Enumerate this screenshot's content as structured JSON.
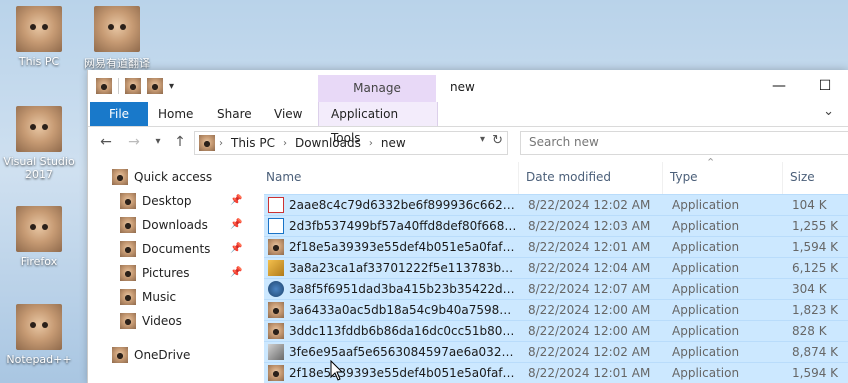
{
  "desktop": {
    "icons": [
      {
        "label": "This PC"
      },
      {
        "label": "网易有道翻译"
      },
      {
        "label": "Visual Studio 2017"
      },
      {
        "label": "Firefox"
      },
      {
        "label": "Notepad++"
      }
    ]
  },
  "window": {
    "title": "new",
    "manage_tab": "Manage",
    "controls": {
      "minimize": "—",
      "maximize": "☐"
    }
  },
  "ribbon": {
    "tabs": [
      "File",
      "Home",
      "Share",
      "View",
      "Application Tools"
    ],
    "expand_icon": "⌄"
  },
  "address": {
    "crumbs": [
      "This PC",
      "Downloads",
      "new"
    ],
    "search_placeholder": "Search new"
  },
  "nav": {
    "items": [
      {
        "label": "Quick access"
      },
      {
        "label": "Desktop",
        "pinned": true
      },
      {
        "label": "Downloads",
        "pinned": true
      },
      {
        "label": "Documents",
        "pinned": true
      },
      {
        "label": "Pictures",
        "pinned": true
      },
      {
        "label": "Music"
      },
      {
        "label": "Videos"
      },
      {
        "label": "OneDrive"
      }
    ]
  },
  "table": {
    "headers": {
      "name": "Name",
      "date": "Date modified",
      "type": "Type",
      "size": "Size"
    },
    "rows": [
      {
        "name": "2aae8c4c79d6332be6f899936c662326250d...",
        "date": "8/22/2024 12:02 AM",
        "type": "Application",
        "size": "104 K",
        "icon": "pdf-icon"
      },
      {
        "name": "2d3fb537499bf57a40ffd8def80f6685de2e2...",
        "date": "8/22/2024 12:03 AM",
        "type": "Application",
        "size": "1,255 K",
        "icon": "window-icon"
      },
      {
        "name": "2f18e5a39393e55def4b051e5a0faf2f9cc0d...",
        "date": "8/22/2024 12:01 AM",
        "type": "Application",
        "size": "1,594 K",
        "icon": "cat-icon"
      },
      {
        "name": "3a8a23ca1af33701222f5e113783baf30e52...",
        "date": "8/22/2024 12:04 AM",
        "type": "Application",
        "size": "6,125 K",
        "icon": "tool-icon"
      },
      {
        "name": "3a8f5f6951dad3ba415b23b35422d3c93f86...",
        "date": "8/22/2024 12:07 AM",
        "type": "Application",
        "size": "304 K",
        "icon": "globe-icon"
      },
      {
        "name": "3a6433a0ac5db18a54c9b40a75981a6bf2c...",
        "date": "8/22/2024 12:00 AM",
        "type": "Application",
        "size": "1,823 K",
        "icon": "cat-icon"
      },
      {
        "name": "3ddc113fddb6b86da16dc0cc51b80b04a9...",
        "date": "8/22/2024 12:00 AM",
        "type": "Application",
        "size": "828 K",
        "icon": "cat-icon"
      },
      {
        "name": "3fe6e95aaf5e6563084597ae6a03283dc6e8...",
        "date": "8/22/2024 12:02 AM",
        "type": "Application",
        "size": "8,874 K",
        "icon": "pen-icon"
      },
      {
        "name": "2f18e5a39393e55def4b051e5a0faf2f9cc0d...",
        "date": "8/22/2024 12:01 AM",
        "type": "Application",
        "size": "1,594 K",
        "icon": "cat-icon"
      }
    ]
  }
}
